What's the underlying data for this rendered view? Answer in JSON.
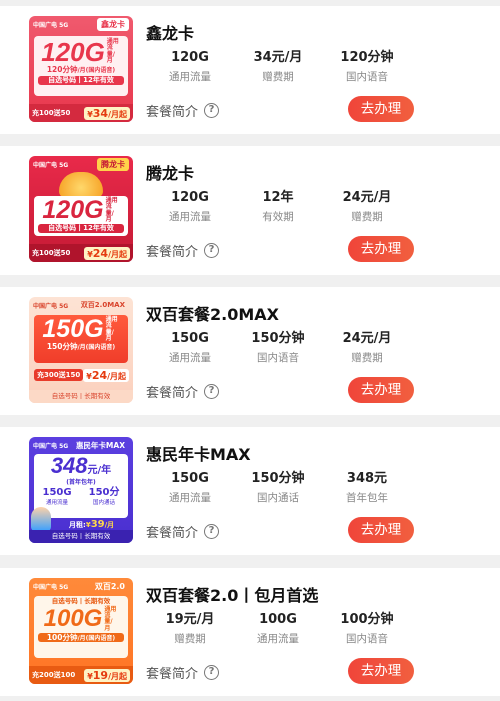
{
  "packages": [
    {
      "title": "鑫龙卡",
      "stats": [
        {
          "value": "120G",
          "label": "通用流量"
        },
        {
          "value": "34元/月",
          "label": "赠费期"
        },
        {
          "value": "120分钟",
          "label": "国内语音"
        }
      ],
      "intro": "套餐简介",
      "action": "去办理",
      "thumb": {
        "logo": "中国广电 5G",
        "tag": "鑫龙卡",
        "big": "120G",
        "big_note": "通用流量/月",
        "line1": "120分钟",
        "line1_note": "/月(国内语音)",
        "strip": "自选号码丨12年有效",
        "promo": "充100送50",
        "price_symbol": "¥",
        "price_num": "34",
        "price_unit": "/月起"
      }
    },
    {
      "title": "腾龙卡",
      "stats": [
        {
          "value": "120G",
          "label": "通用流量"
        },
        {
          "value": "12年",
          "label": "有效期"
        },
        {
          "value": "24元/月",
          "label": "赠费期"
        }
      ],
      "intro": "套餐简介",
      "action": "去办理",
      "thumb": {
        "logo": "中国广电 5G",
        "tag": "腾龙卡",
        "big": "120G",
        "big_note": "通用流量/月",
        "strip": "自选号码丨12年有效",
        "promo": "充100送50",
        "price_symbol": "¥",
        "price_num": "24",
        "price_unit": "/月起"
      }
    },
    {
      "title": "双百套餐2.0MAX",
      "stats": [
        {
          "value": "150G",
          "label": "通用流量"
        },
        {
          "value": "150分钟",
          "label": "国内语音"
        },
        {
          "value": "24元/月",
          "label": "赠费期"
        }
      ],
      "intro": "套餐简介",
      "action": "去办理",
      "thumb": {
        "logo": "中国广电 5G",
        "tag": "双百2.0MAX",
        "big": "150G",
        "big_note": "通用流量/月",
        "line1": "150分钟",
        "line1_note": "/月(国内语音)",
        "promo": "充300送150",
        "price_symbol": "¥",
        "price_num": "24",
        "price_unit": "/月起",
        "foot": "自选号码丨长期有效"
      }
    },
    {
      "title": "惠民年卡MAX",
      "stats": [
        {
          "value": "150G",
          "label": "通用流量"
        },
        {
          "value": "150分钟",
          "label": "国内通话"
        },
        {
          "value": "348元",
          "label": "首年包年"
        }
      ],
      "intro": "套餐简介",
      "action": "去办理",
      "thumb": {
        "logo": "中国广电 5G",
        "tag": "惠民年卡MAX",
        "big": "348",
        "big_unit": "元/年",
        "big_note": "(首年包年)",
        "mini1": "150G",
        "mini1_note": "通用流量",
        "mini2": "150分",
        "mini2_note": "国内通话",
        "monthly_label": "月租:",
        "price_symbol": "¥",
        "price_num": "39",
        "price_unit": "/月",
        "foot": "自选号码丨长期有效"
      }
    },
    {
      "title": "双百套餐2.0丨包月首选",
      "stats": [
        {
          "value": "19元/月",
          "label": "赠费期"
        },
        {
          "value": "100G",
          "label": "通用流量"
        },
        {
          "value": "100分钟",
          "label": "国内语音"
        }
      ],
      "intro": "套餐简介",
      "action": "去办理",
      "thumb": {
        "logo": "中国广电 5G",
        "tag": "双百2.0",
        "line0": "自选号码丨长期有效",
        "big": "100G",
        "big_note": "通用流量/月",
        "line1": "100分钟",
        "line1_note": "/月(国内语音)",
        "promo": "充200送100",
        "price_symbol": "¥",
        "price_num": "19",
        "price_unit": "/月起"
      }
    }
  ],
  "colors": {
    "action_button": "#f04a3b",
    "label_gray": "#888888",
    "price_red": "#e53b10"
  },
  "icons": {
    "help": "question-circle-icon"
  }
}
